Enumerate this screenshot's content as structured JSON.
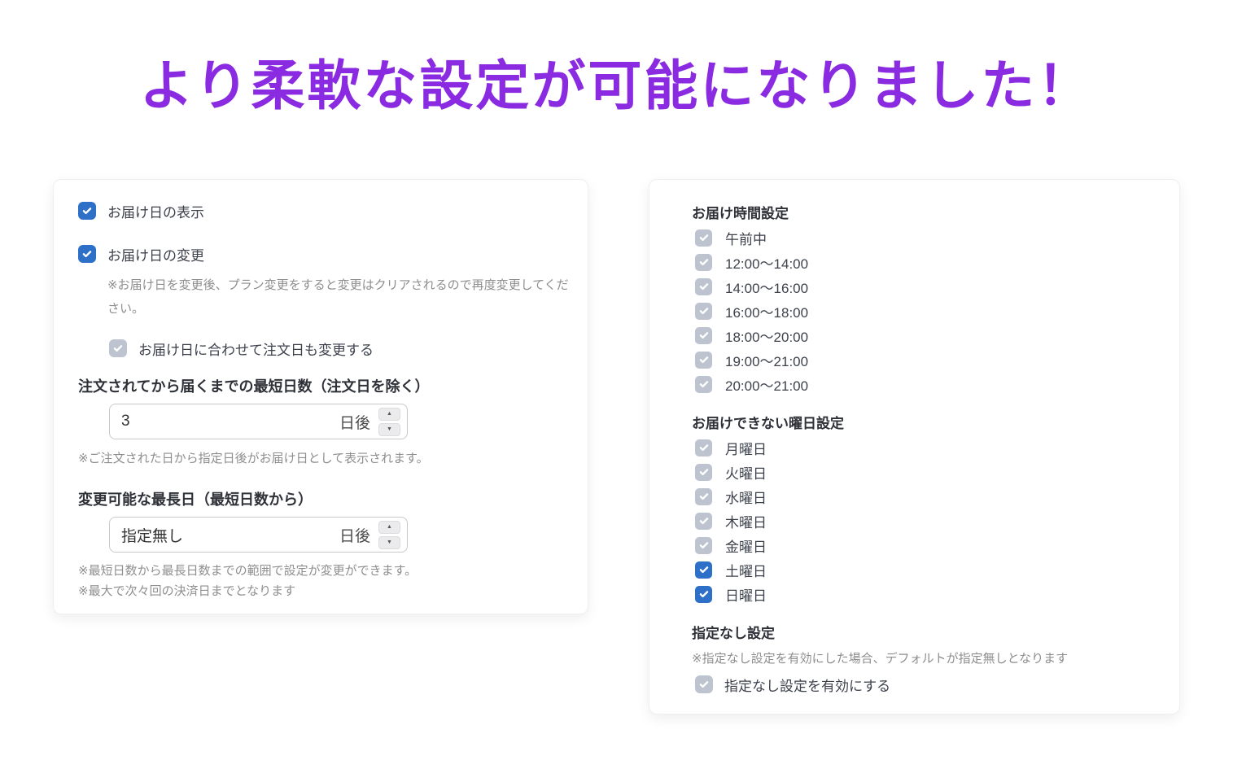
{
  "page": {
    "title": "より柔軟な設定が可能になりました！"
  },
  "colors": {
    "accent_purple": "#8A2BE2",
    "checkbox_enabled_blue": "#2E70C8",
    "checkbox_disabled_gray": "#BDC4CF"
  },
  "icons": {
    "check": "check-icon",
    "spinner_up": "▲",
    "spinner_down": "▼"
  },
  "left_card": {
    "show_delivery_date": {
      "label": "お届け日の表示",
      "checked": true,
      "disabled": false
    },
    "change_delivery_date": {
      "label": "お届け日の変更",
      "checked": true,
      "disabled": false
    },
    "change_note": "※お届け日を変更後、プラン変更をすると変更はクリアされるので再度変更してください。",
    "sync_order_date": {
      "label": "お届け日に合わせて注文日も変更する",
      "checked": true,
      "disabled": true
    },
    "min_days": {
      "label": "注文されてから届くまでの最短日数（注文日を除く）",
      "value": "3",
      "unit": "日後",
      "note": "※ご注文された日から指定日後がお届け日として表示されます。"
    },
    "max_days": {
      "label": "変更可能な最長日（最短日数から）",
      "value": "指定無し",
      "unit": "日後",
      "note1": "※最短日数から最長日数までの範囲で設定が変更ができます。",
      "note2": "※最大で次々回の決済日までとなります"
    }
  },
  "right_card": {
    "time_section": {
      "heading": "お届け時間設定",
      "options": [
        {
          "label": "午前中",
          "checked": true,
          "disabled": true
        },
        {
          "label": "12:00〜14:00",
          "checked": true,
          "disabled": true
        },
        {
          "label": "14:00〜16:00",
          "checked": true,
          "disabled": true
        },
        {
          "label": "16:00〜18:00",
          "checked": true,
          "disabled": true
        },
        {
          "label": "18:00〜20:00",
          "checked": true,
          "disabled": true
        },
        {
          "label": "19:00〜21:00",
          "checked": true,
          "disabled": true
        },
        {
          "label": "20:00〜21:00",
          "checked": true,
          "disabled": true
        }
      ]
    },
    "weekday_section": {
      "heading": "お届けできない曜日設定",
      "options": [
        {
          "label": "月曜日",
          "checked": true,
          "disabled": true
        },
        {
          "label": "火曜日",
          "checked": true,
          "disabled": true
        },
        {
          "label": "水曜日",
          "checked": true,
          "disabled": true
        },
        {
          "label": "木曜日",
          "checked": true,
          "disabled": true
        },
        {
          "label": "金曜日",
          "checked": true,
          "disabled": true
        },
        {
          "label": "土曜日",
          "checked": true,
          "disabled": false
        },
        {
          "label": "日曜日",
          "checked": true,
          "disabled": false
        }
      ]
    },
    "nospec_section": {
      "heading": "指定なし設定",
      "note": "※指定なし設定を有効にした場合、デフォルトが指定無しとなります",
      "option": {
        "label": "指定なし設定を有効にする",
        "checked": true,
        "disabled": true
      }
    }
  }
}
